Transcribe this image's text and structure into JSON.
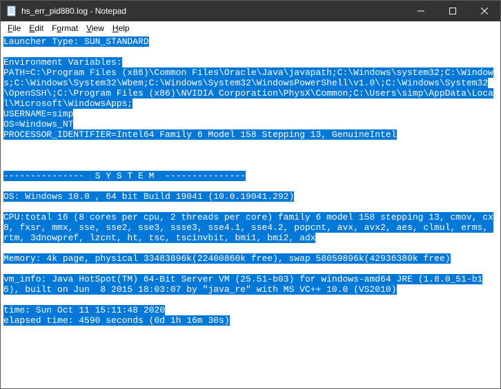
{
  "window": {
    "title": "hs_err_pid880.log - Notepad"
  },
  "menu": {
    "file": "File",
    "edit": "Edit",
    "format": "Format",
    "view": "View",
    "help": "Help"
  },
  "log": {
    "launcher_type": "Launcher Type: SUN_STANDARD",
    "env_header": "Environment Variables:",
    "path": "PATH=C:\\Program Files (x86)\\Common Files\\Oracle\\Java\\javapath;C:\\Windows\\system32;C:\\Windows;C:\\Windows\\System32\\Wbem;C:\\Windows\\System32\\WindowsPowerShell\\v1.0\\;C:\\Windows\\System32\\OpenSSH\\;C:\\Program Files (x86)\\NVIDIA Corporation\\PhysX\\Common;C:\\Users\\simp\\AppData\\Local\\Microsoft\\WindowsApps;",
    "username": "USERNAME=simp",
    "os_env": "OS=Windows_NT",
    "processor": "PROCESSOR_IDENTIFIER=Intel64 Family 6 Model 158 Stepping 13, GenuineIntel",
    "system_sep": "---------------  S Y S T E M  ---------------",
    "os_line": "OS: Windows 10.0 , 64 bit Build 19041 (10.0.19041.292)",
    "cpu_line": "CPU:total 16 (8 cores per cpu, 2 threads per core) family 6 model 158 stepping 13, cmov, cx8, fxsr, mmx, sse, sse2, sse3, ssse3, sse4.1, sse4.2, popcnt, avx, avx2, aes, clmul, erms, rtm, 3dnowpref, lzcnt, ht, tsc, tscinvbit, bmi1, bmi2, adx",
    "memory_line": "Memory: 4k page, physical 33483896k(22400860k free), swap 58059896k(42936380k free)",
    "vm_info": "vm_info: Java HotSpot(TM) 64-Bit Server VM (25.51-b03) for windows-amd64 JRE (1.8.0_51-b16), built on Jun  8 2015 18:03:07 by \"java_re\" with MS VC++ 10.0 (VS2010)",
    "time_line": "time: Sun Oct 11 15:11:48 2020",
    "elapsed_line": "elapsed time: 4590 seconds (0d 1h 16m 30s)"
  }
}
